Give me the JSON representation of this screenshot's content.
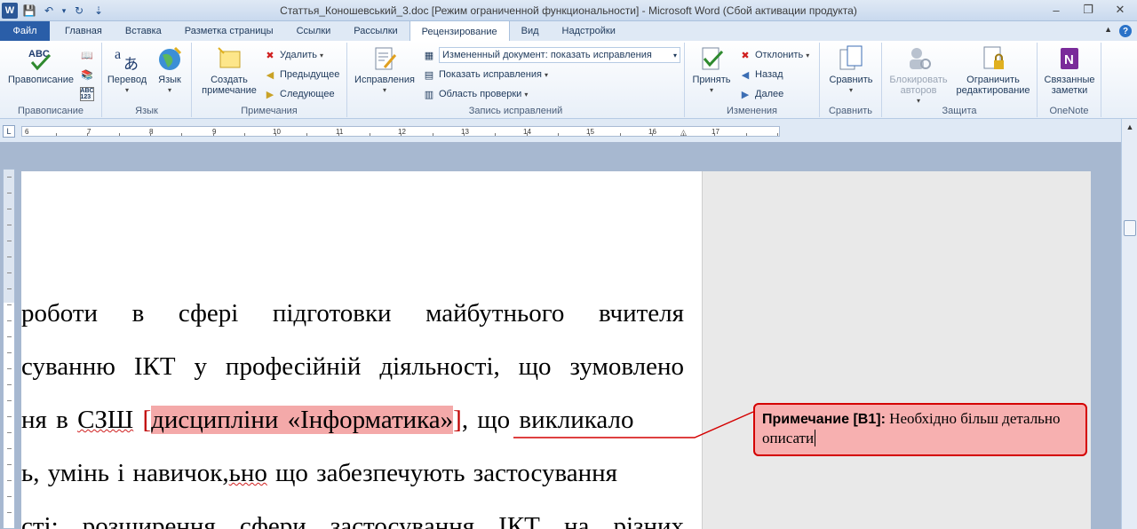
{
  "window": {
    "title": "Статтья_Коношевський_3.doc [Режим ограниченной функциональности]  -  Microsoft Word (Сбой активации продукта)",
    "app_icon": "W",
    "controls": {
      "minimize": "–",
      "restore": "❐",
      "close": "✕"
    }
  },
  "qat": {
    "save": "💾",
    "undo": "↶",
    "dd": "▾",
    "repeat": "↻",
    "custom": "⇣"
  },
  "tabs": [
    {
      "label": "Файл"
    },
    {
      "label": "Главная"
    },
    {
      "label": "Вставка"
    },
    {
      "label": "Разметка страницы"
    },
    {
      "label": "Ссылки"
    },
    {
      "label": "Рассылки"
    },
    {
      "label": "Рецензирование"
    },
    {
      "label": "Вид"
    },
    {
      "label": "Надстройки"
    }
  ],
  "ribbon": {
    "spelling": {
      "label": "Правописание",
      "button": "Правописание"
    },
    "language": {
      "label": "Язык",
      "translate": "Перевод",
      "language": "Язык"
    },
    "comments": {
      "label": "Примечания",
      "create": "Создать примечание",
      "delete": "Удалить",
      "previous": "Предыдущее",
      "next": "Следующее"
    },
    "tracking": {
      "label": "Запись исправлений",
      "track_changes": "Исправления",
      "display_combo": "Измененный документ: показать исправления",
      "show_markup": "Показать исправления",
      "reviewing_pane": "Область проверки"
    },
    "changes": {
      "label": "Изменения",
      "accept": "Принять",
      "reject": "Отклонить",
      "back": "Назад",
      "forward": "Далее"
    },
    "compare": {
      "label": "Сравнить",
      "button": "Сравнить"
    },
    "protect": {
      "label": "Защита",
      "block_authors": "Блокировать авторов",
      "restrict": "Ограничить редактирование"
    },
    "onenote": {
      "label": "OneNote",
      "linked_notes": "Связанные заметки"
    }
  },
  "ruler": {
    "ticks": [
      "6",
      "7",
      "8",
      "9",
      "10",
      "11",
      "12",
      "13",
      "14",
      "15",
      "16",
      "17"
    ]
  },
  "document": {
    "line1": "роботи в сфері підготовки майбутнього вчителя",
    "line2": "суванню ІКТ у професійній діяльності, що зумовлено",
    "line3_pre": "ня в ",
    "line3_szsh": "СЗШ",
    "line3_sp": " ",
    "line3_hl": "дисципліни «Інформатика»",
    "line3_post": ", що викликало",
    "line4_pre": "ь, умінь і навичок,",
    "line4_sq": "ьно",
    "line4_post": " що забезпечують застосування",
    "line5": "сті; розширення сфери застосування ІКТ на різних"
  },
  "comment": {
    "label": "Примечание [B1]:",
    "text": "Необхідно більш детально описати"
  }
}
